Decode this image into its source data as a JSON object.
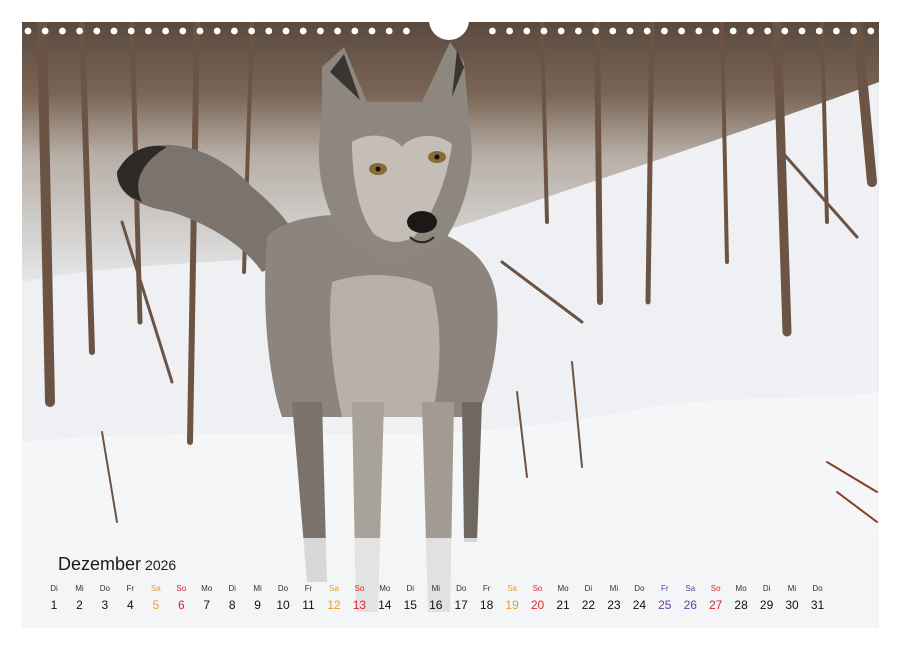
{
  "calendar": {
    "month": "Dezember",
    "year": "2026",
    "days": [
      {
        "dow": "Di",
        "num": "1",
        "type": "normal"
      },
      {
        "dow": "Mi",
        "num": "2",
        "type": "normal"
      },
      {
        "dow": "Do",
        "num": "3",
        "type": "normal"
      },
      {
        "dow": "Fr",
        "num": "4",
        "type": "normal"
      },
      {
        "dow": "Sa",
        "num": "5",
        "type": "sat"
      },
      {
        "dow": "So",
        "num": "6",
        "type": "sun"
      },
      {
        "dow": "Mo",
        "num": "7",
        "type": "normal"
      },
      {
        "dow": "Di",
        "num": "8",
        "type": "normal"
      },
      {
        "dow": "Mi",
        "num": "9",
        "type": "normal"
      },
      {
        "dow": "Do",
        "num": "10",
        "type": "normal"
      },
      {
        "dow": "Fr",
        "num": "11",
        "type": "normal"
      },
      {
        "dow": "Sa",
        "num": "12",
        "type": "sat"
      },
      {
        "dow": "So",
        "num": "13",
        "type": "sun"
      },
      {
        "dow": "Mo",
        "num": "14",
        "type": "normal"
      },
      {
        "dow": "Di",
        "num": "15",
        "type": "normal"
      },
      {
        "dow": "Mi",
        "num": "16",
        "type": "normal"
      },
      {
        "dow": "Do",
        "num": "17",
        "type": "normal"
      },
      {
        "dow": "Fr",
        "num": "18",
        "type": "normal"
      },
      {
        "dow": "Sa",
        "num": "19",
        "type": "sat"
      },
      {
        "dow": "So",
        "num": "20",
        "type": "sun"
      },
      {
        "dow": "Mo",
        "num": "21",
        "type": "normal"
      },
      {
        "dow": "Di",
        "num": "22",
        "type": "normal"
      },
      {
        "dow": "Mi",
        "num": "23",
        "type": "normal"
      },
      {
        "dow": "Do",
        "num": "24",
        "type": "normal"
      },
      {
        "dow": "Fr",
        "num": "25",
        "type": "hol"
      },
      {
        "dow": "Sa",
        "num": "26",
        "type": "hol"
      },
      {
        "dow": "So",
        "num": "27",
        "type": "sun"
      },
      {
        "dow": "Mo",
        "num": "28",
        "type": "normal"
      },
      {
        "dow": "Di",
        "num": "29",
        "type": "normal"
      },
      {
        "dow": "Mi",
        "num": "30",
        "type": "normal"
      },
      {
        "dow": "Do",
        "num": "31",
        "type": "normal"
      }
    ]
  },
  "photo": {
    "subject": "wolf-in-snowy-forest"
  },
  "colors": {
    "saturday": "#e0a030",
    "sunday": "#d8252b",
    "holiday": "#6a3fa0"
  }
}
